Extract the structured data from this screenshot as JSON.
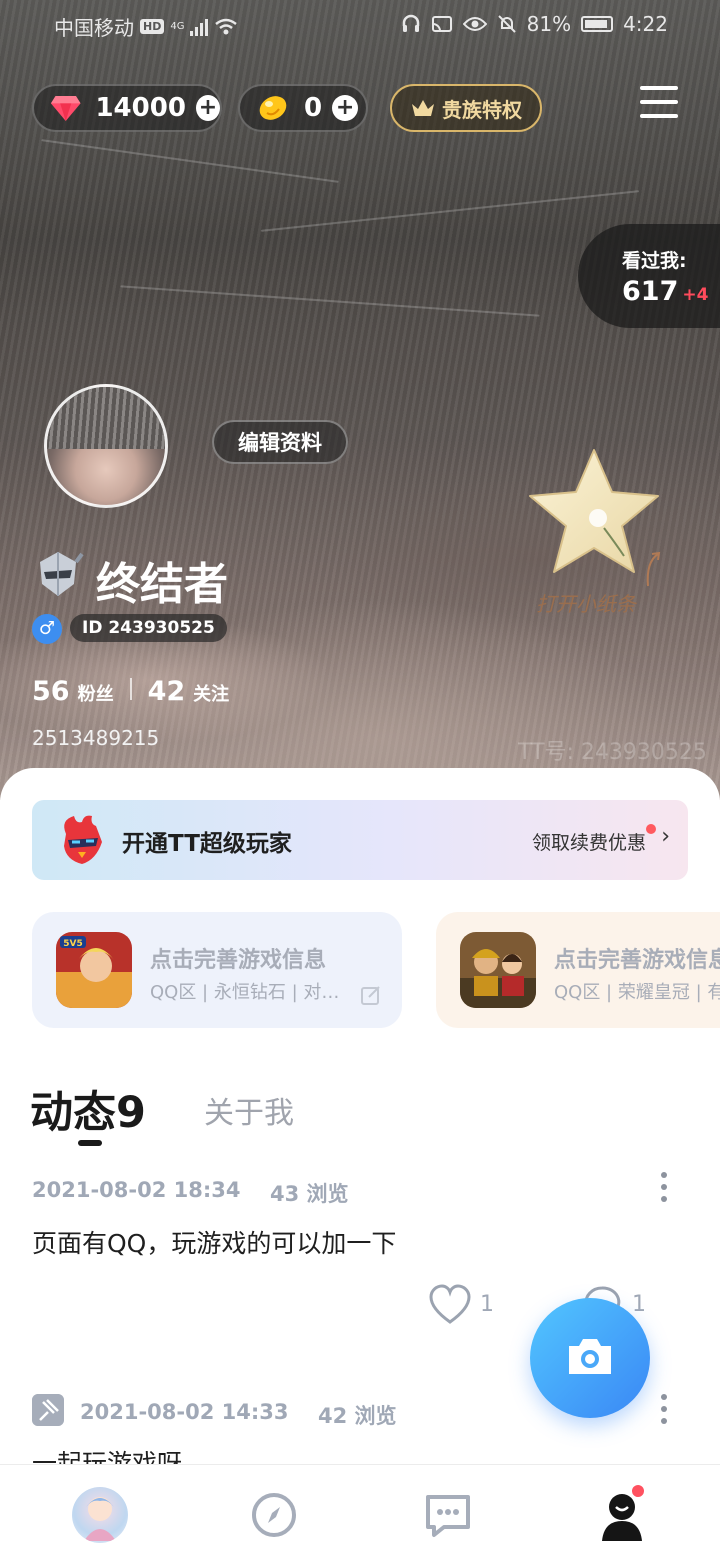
{
  "status_bar": {
    "carrier": "中国移动",
    "hd": "HD",
    "network": "4G",
    "battery": "81%",
    "time": "4:22"
  },
  "top_bar": {
    "diamonds": "14000",
    "beans": "0",
    "noble_label": "贵族特权"
  },
  "visitors": {
    "label": "看过我:",
    "count": "617",
    "delta": "+4"
  },
  "profile": {
    "edit_label": "编辑资料",
    "nickname": "终结者",
    "gender_symbol": "♂",
    "id_text": "ID 243930525",
    "fans_count": "56",
    "fans_label": "粉丝",
    "following_count": "42",
    "following_label": "关注",
    "qq_number": "2513489215",
    "tt_watermark": "TT号: 243930525",
    "paper_hint": "打开小纸条"
  },
  "super_player": {
    "title": "开通TT超级玩家",
    "offer": "领取续费优惠",
    "chevron": "›"
  },
  "games": [
    {
      "title": "点击完善游戏信息",
      "subtitle": "QQ区 | 永恒钻石 | 对…"
    },
    {
      "title": "点击完善游戏信息",
      "subtitle": "QQ区 | 荣耀皇冠 | 有"
    }
  ],
  "tabs": {
    "feed": "动态9",
    "about": "关于我"
  },
  "posts": [
    {
      "date": "2021-08-02  18:34",
      "views": "43 浏览",
      "text": "页面有QQ，玩游戏的可以加一下",
      "likes": "1",
      "comments": "1"
    },
    {
      "date": "2021-08-02  14:33",
      "views": "42 浏览",
      "text": "一起玩游戏呀"
    }
  ],
  "colors": {
    "accent_blue": "#3a87f5",
    "badge_red": "#ff5160",
    "noble_gold": "#d9b66a"
  },
  "icons": {
    "diamond": "diamond-icon",
    "bean": "bean-icon",
    "crown": "crown-icon",
    "menu": "menu-icon",
    "camera": "camera-icon",
    "discover": "compass-icon",
    "chat": "chat-bubble-icon",
    "me": "person-icon"
  }
}
